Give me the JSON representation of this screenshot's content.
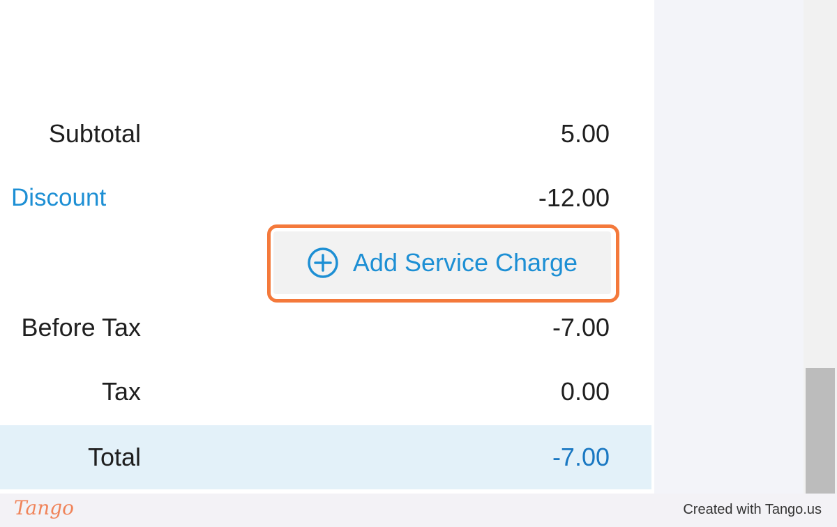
{
  "summary": {
    "subtotal": {
      "label": "Subtotal",
      "value": "5.00"
    },
    "discount": {
      "label": "Discount",
      "value": "-12.00"
    },
    "add_service_charge": {
      "label": "Add Service Charge",
      "icon": "plus-circle-icon"
    },
    "before_tax": {
      "label": "Before Tax",
      "value": "-7.00"
    },
    "tax": {
      "label": "Tax",
      "value": "0.00"
    },
    "total": {
      "label": "Total",
      "value": "-7.00"
    }
  },
  "footer": {
    "logo": "Tango",
    "credit": "Created with Tango.us"
  },
  "colors": {
    "accent_blue": "#1d8fd4",
    "highlight_orange": "#f4793b",
    "total_band": "#e3f1f9"
  }
}
